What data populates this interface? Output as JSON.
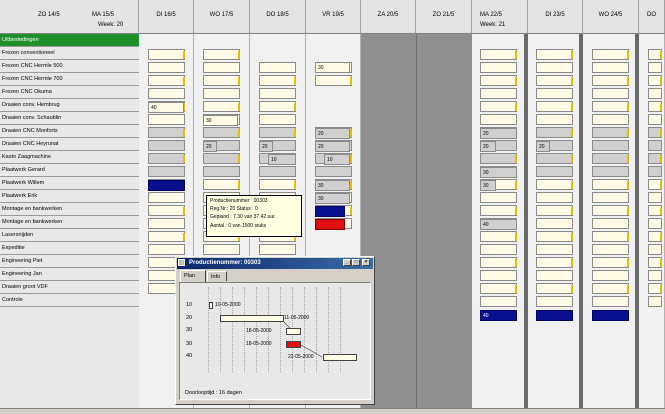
{
  "header": {
    "columns": [
      {
        "date": "ZO 14/5",
        "week": ""
      },
      {
        "date": "MA 15/5",
        "week": "Week: 20"
      },
      {
        "date": "DI 16/5",
        "week": ""
      },
      {
        "date": "WO 17/5",
        "week": ""
      },
      {
        "date": "DO 18/5",
        "week": ""
      },
      {
        "date": "VR 19/5",
        "week": ""
      },
      {
        "date": "ZA 20/5",
        "week": ""
      },
      {
        "date": "ZO 21/5",
        "week": ""
      },
      {
        "date": "MA 22/5",
        "week": "Week: 21"
      },
      {
        "date": "DI 23/5",
        "week": ""
      },
      {
        "date": "WO 24/5",
        "week": ""
      },
      {
        "date": "DO",
        "week": ""
      }
    ]
  },
  "resources": [
    "Uitbestedingen",
    "Frezen conventioneel",
    "Frezen CNC Hermle 500",
    "Frezen CNC Hermle 700",
    "Frezen CNC Okuma",
    "Draaien conv. Hembrug",
    "Draaien conv. Schaublin",
    "Draaien CNC Monforts",
    "Draaien CNC Heyrunat",
    "Kasto Zaagmachine",
    "Plaatwerk Gerard",
    "Plaatwerk Willem",
    "Plaatwerk Erik",
    "Montage en bankwerken",
    "Montage en bankwerken",
    "Lasersnijden",
    "Expeditie",
    "Engineering Piet",
    "Engineering Jan",
    "Draaien groot VDF",
    "Controle"
  ],
  "cell_labels": {
    "c40": "40",
    "c30a": "30",
    "c30b": "30",
    "c20a": "20",
    "c20b": "20",
    "c20c": "20",
    "c20d": "20",
    "c20e": "20",
    "c10a": "10",
    "c10b": "10",
    "c30c": "30",
    "c30d": "30",
    "c20f": "20",
    "c20g": "20",
    "c30e": "30",
    "c30f": "30",
    "c40b": "40",
    "c40c": "40"
  },
  "tooltip": {
    "line1": "Productienummer : 00303",
    "line2": "Reg.Nr.: 20  Status : 0",
    "line3": "Gepland : 7.30 van 37.42 uur",
    "line4": "Aantal : 0 van 1500 stuks"
  },
  "popup": {
    "title": "Productienummer: 00303",
    "tabs": [
      "Plan",
      "Info"
    ],
    "ops": [
      "10",
      "20",
      "30",
      "30",
      "40"
    ],
    "dates": {
      "d1": "10-05-2000",
      "d2": "11-05-2000",
      "d3": "18-05-2000",
      "d4": "18-05-2000",
      "d5": "22-05-2000"
    },
    "throughput": "Doorlooptijd : 16 dagen"
  },
  "colors": {
    "active_row": "#1e8f2a",
    "planned": "#0a0f8f",
    "late": "#e01010",
    "weekend": "#8f8f8f"
  }
}
